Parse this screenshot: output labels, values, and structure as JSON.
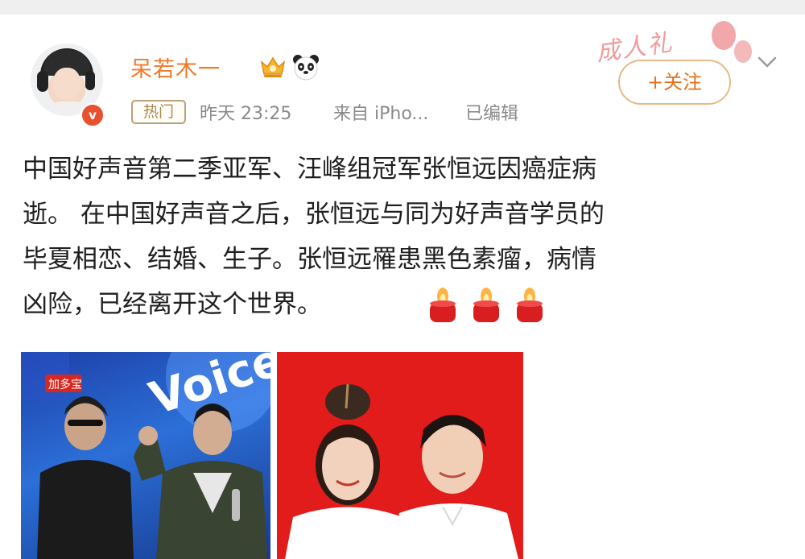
{
  "user": {
    "name": "呆若木一",
    "verified_mark": "v",
    "follow_label": "+关注"
  },
  "meta": {
    "badge": "热门",
    "time": "昨天 23:25",
    "source": "来自 iPho...",
    "edited": "已编辑"
  },
  "decoration": {
    "text": "成人礼"
  },
  "post": {
    "lines": [
      "中国好声音第二季亚军、汪峰组冠军张恒远因癌症病",
      "逝。 在中国好声音之后，张恒远与同为好声音学员的",
      "毕夏相恋、结婚、生子。张恒远罹患黑色素瘤，病情",
      "凶险，已经离开这个世界。"
    ]
  },
  "photos": {
    "photo1_logo": "Voice",
    "photo1_badge": "加多宝"
  },
  "icons": [
    "vip-crown-icon",
    "panda-icon",
    "chevron-down-icon",
    "candle-icon"
  ],
  "colors": {
    "username": "#f07a2a",
    "follow": "#e2711f",
    "badge": "#a9884f",
    "photo2_bg": "#e21b1b"
  }
}
